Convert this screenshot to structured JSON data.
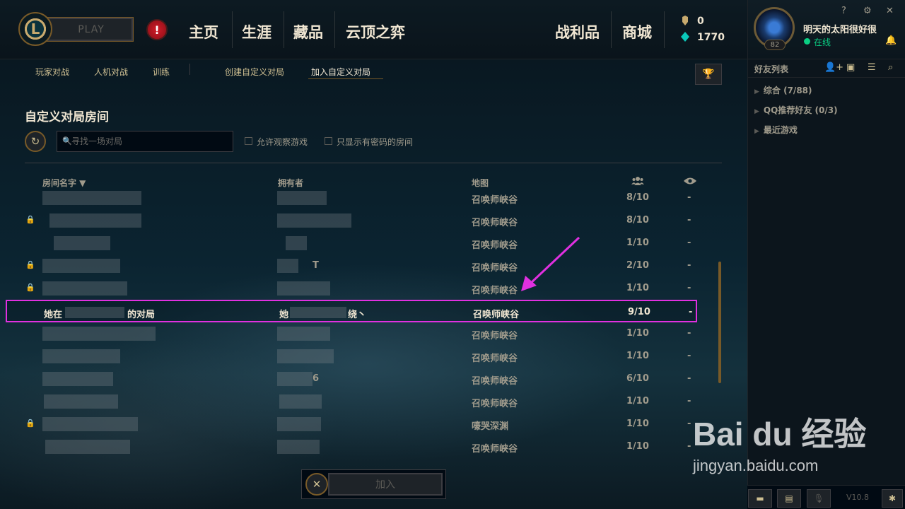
{
  "topnav": {
    "play_label": "PLAY",
    "alert_symbol": "!",
    "items": [
      "主页",
      "生涯",
      "藏品",
      "云顶之弈"
    ],
    "right_items": [
      "战利品",
      "商城"
    ],
    "currency": [
      {
        "icon": "blue-essence-icon",
        "value": "0"
      },
      {
        "icon": "riot-points-icon",
        "value": "1770"
      }
    ]
  },
  "profile": {
    "name": "明天的太阳很好很",
    "level": "82",
    "status": "在线",
    "window_controls": [
      "?",
      "⚙",
      "✕"
    ]
  },
  "friends": {
    "title": "好友列表",
    "groups": [
      {
        "label": "综合 (7/88)"
      },
      {
        "label": "QQ推荐好友 (0/3)"
      },
      {
        "label": "最近游戏"
      }
    ]
  },
  "subnav": {
    "items": [
      "玩家对战",
      "人机对战",
      "训练"
    ],
    "custom_items": [
      "创建自定义对局",
      "加入自定义对局"
    ],
    "active": "加入自定义对局"
  },
  "lobby": {
    "title": "自定义对局房间",
    "search_placeholder": "寻找一场对局",
    "checkboxes": [
      "允许观察游戏",
      "只显示有密码的房间"
    ],
    "columns": {
      "name": "房间名字 ▼",
      "owner": "拥有者",
      "map": "地图"
    },
    "rows": [
      {
        "name": "",
        "owner": "",
        "map": "召唤师峡谷",
        "players": "8/10",
        "spectate": "-"
      },
      {
        "name": "",
        "owner": "",
        "map": "召唤师峡谷",
        "players": "8/10",
        "spectate": "-"
      },
      {
        "name": "",
        "owner": "",
        "map": "召唤师峡谷",
        "players": "1/10",
        "spectate": "-"
      },
      {
        "name": "",
        "owner": "T",
        "map": "召唤师峡谷",
        "players": "2/10",
        "spectate": "-"
      },
      {
        "name": "",
        "owner": "",
        "map": "召唤师峡谷",
        "players": "1/10",
        "spectate": "-"
      },
      {
        "name": "她在",
        "name_suffix": "的对局",
        "owner": "她",
        "owner_suffix": "绕丶",
        "map": "召唤师峡谷",
        "players": "9/10",
        "spectate": "-"
      },
      {
        "name": "",
        "owner": "",
        "map": "召唤师峡谷",
        "players": "1/10",
        "spectate": "-"
      },
      {
        "name": "",
        "owner": "",
        "map": "召唤师峡谷",
        "players": "1/10",
        "spectate": "-"
      },
      {
        "name": "",
        "owner": "6",
        "map": "召唤师峡谷",
        "players": "6/10",
        "spectate": "-"
      },
      {
        "name": "",
        "owner": "",
        "map": "召唤师峡谷",
        "players": "1/10",
        "spectate": "-"
      },
      {
        "name": "",
        "owner": "",
        "map": "嚎哭深渊",
        "players": "1/10",
        "spectate": "-"
      },
      {
        "name": "",
        "owner": "",
        "map": "召唤师峡谷",
        "players": "1/10",
        "spectate": "-"
      }
    ]
  },
  "footer": {
    "join_label": "加入",
    "close_symbol": "✕",
    "version": "V10.8"
  },
  "watermark": {
    "brand": "Bai du 经验",
    "url": "jingyan.baidu.com"
  },
  "colors": {
    "gold": "#c8aa6e",
    "highlight_border": "#e030e0",
    "online": "#0acf83"
  }
}
